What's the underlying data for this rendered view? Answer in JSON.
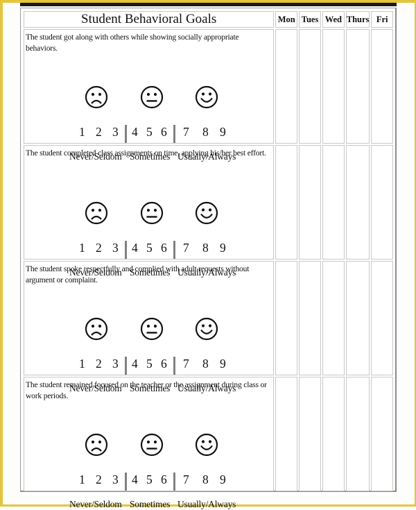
{
  "header": {
    "title": "Student Behavioral Goals",
    "days": [
      "Mon",
      "Tues",
      "Wed",
      "Thurs",
      "Fri"
    ]
  },
  "scale": {
    "numbers": [
      "1",
      "2",
      "3",
      "4",
      "5",
      "6",
      "7",
      "8",
      "9"
    ],
    "labels": [
      "Never/Seldom",
      "Sometimes",
      "Usually/Always"
    ],
    "faces": [
      "frown-face-icon",
      "neutral-face-icon",
      "smile-face-icon"
    ]
  },
  "goals": [
    {
      "text": "The student got along with others while showing socially appropriate  behaviors."
    },
    {
      "text": "The student completed class assignments on time, applying his/her best effort."
    },
    {
      "text": "The student spoke respectfully and complied with adult requests without  argument or complaint."
    },
    {
      "text": "The student remained focused on the teacher or the assignment during class or work periods."
    }
  ],
  "colors": {
    "frame": "#e4c53a",
    "top_rule": "#1a1a1a",
    "grid": "#c8c8c8"
  }
}
